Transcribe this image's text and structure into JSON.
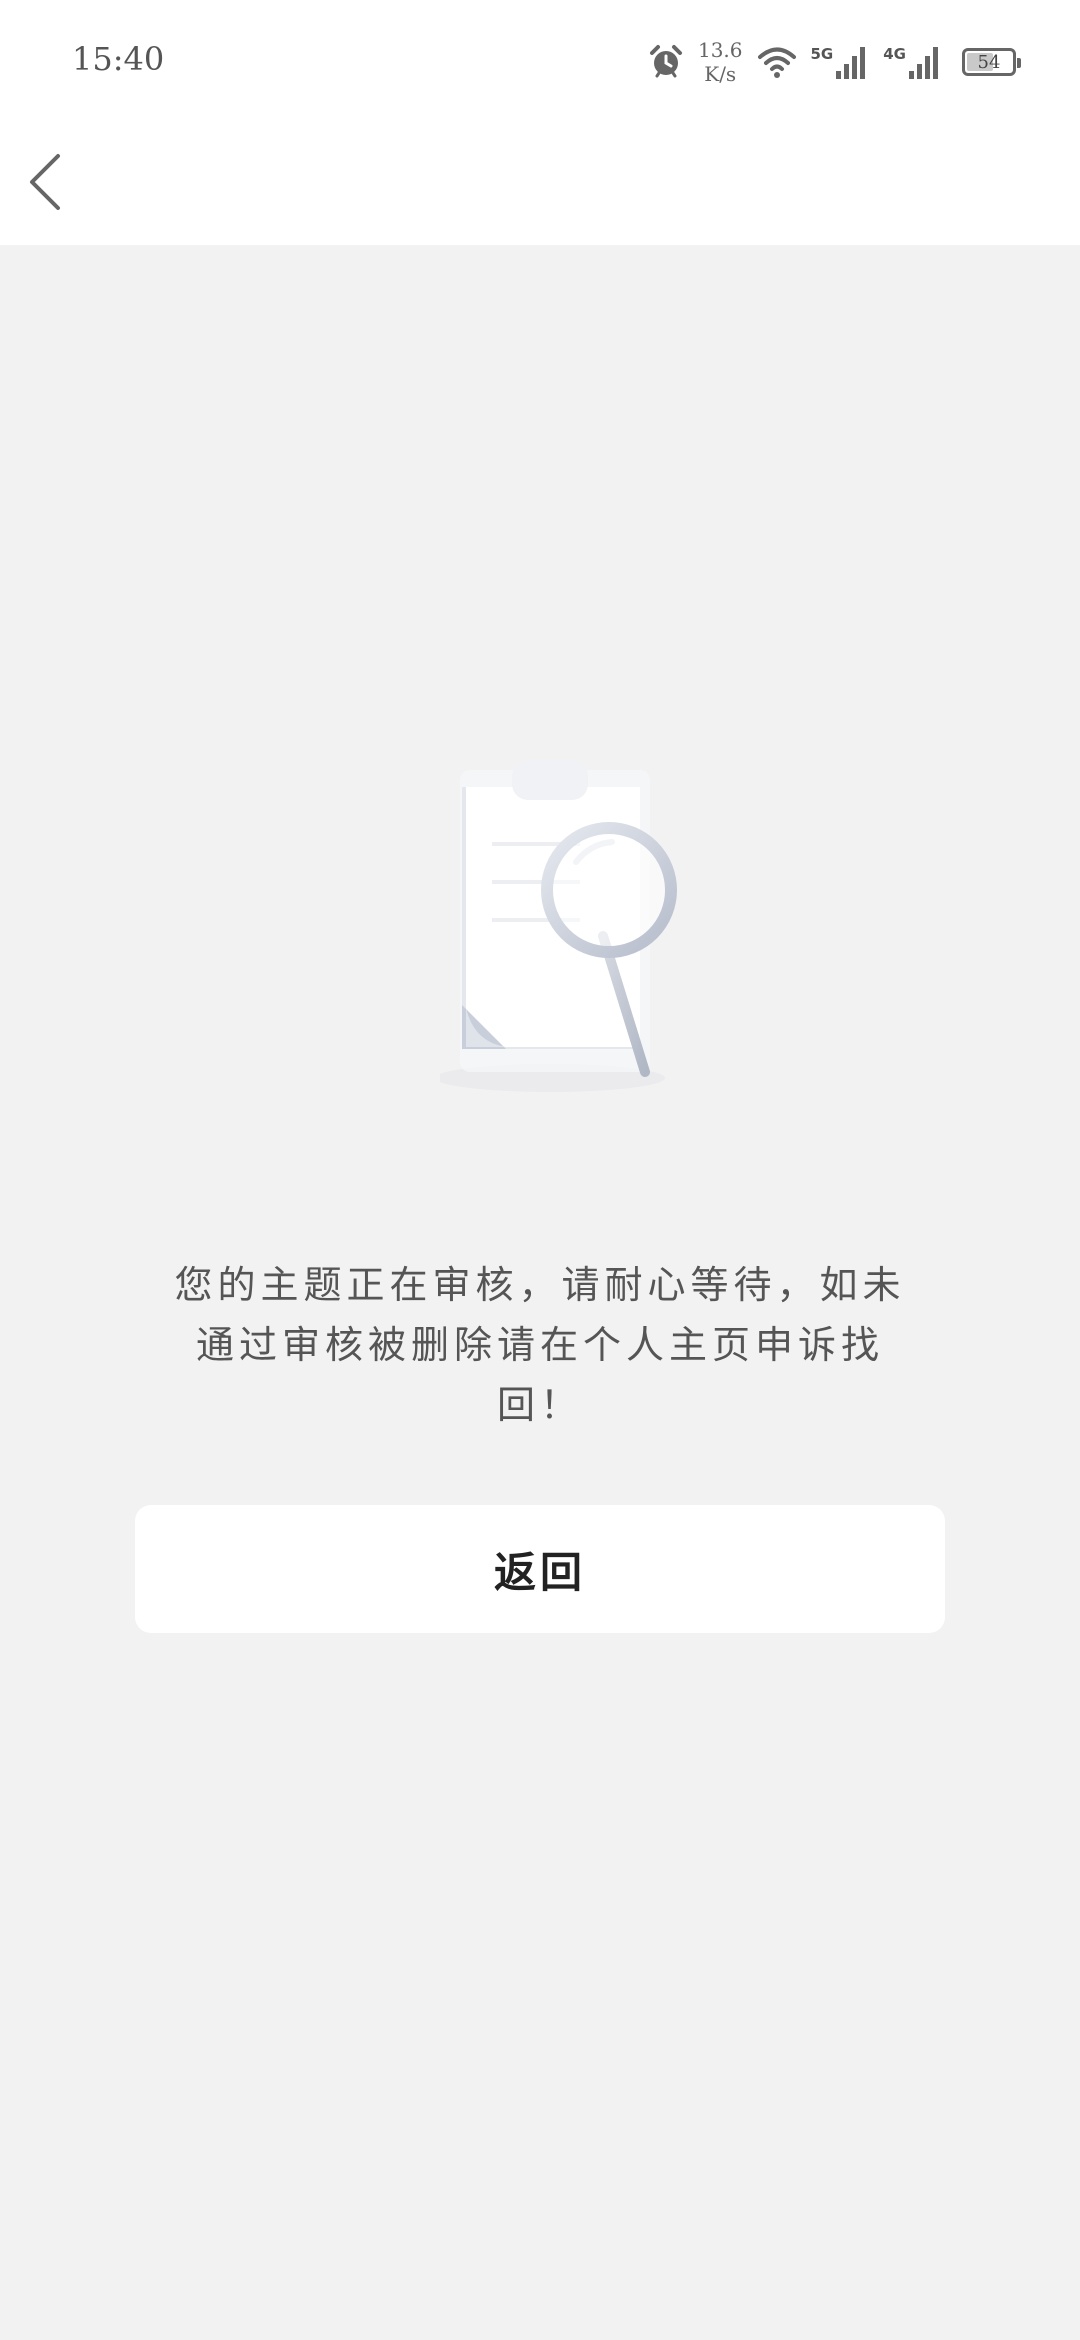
{
  "status_bar": {
    "time": "15:40",
    "net_speed_value": "13.6",
    "net_speed_unit": "K/s",
    "signal_1_label": "5G",
    "signal_2_label": "4G",
    "battery_level": "54"
  },
  "nav": {
    "back_icon": "chevron-left-icon"
  },
  "illustration": {
    "icon": "document-search-icon"
  },
  "message": "您的主题正在审核，请耐心等待，如未通过审核被删除请在个人主页申诉找回！",
  "return_button_label": "返回",
  "colors": {
    "background": "#f2f2f3",
    "surface": "#ffffff",
    "text_secondary": "#555555",
    "text_primary": "#222222"
  }
}
